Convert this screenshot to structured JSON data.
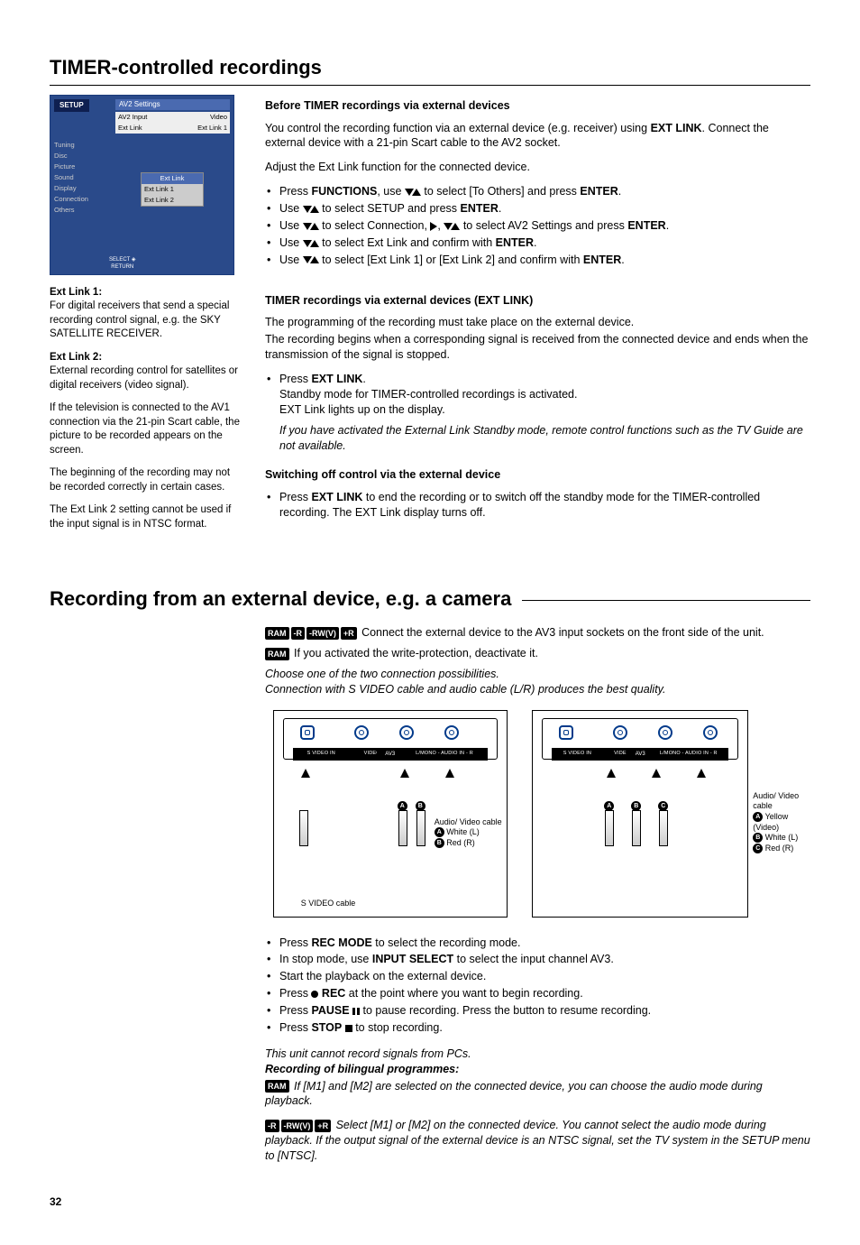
{
  "page_number": "32",
  "section1": {
    "title": "TIMER-controlled recordings",
    "setup_box": {
      "corner": "SETUP",
      "pane_title": "AV2 Settings",
      "rows": [
        {
          "l": "AV2 Input",
          "r": "Video"
        },
        {
          "l": "Ext Link",
          "r": "Ext Link 1"
        }
      ],
      "menu": [
        "Tuning",
        "Disc",
        "Picture",
        "Sound",
        "Display",
        "Connection",
        "Others"
      ],
      "popup_title": "Ext Link",
      "popup_items": [
        "Ext Link 1",
        "Ext Link 2"
      ],
      "hint1": "SELECT",
      "hint2": "RETURN"
    },
    "left": {
      "el1_label": "Ext Link 1:",
      "el1_text": "For digital receivers that send a special recording control signal, e.g. the SKY SATELLITE RECEIVER.",
      "el2_label": "Ext Link 2:",
      "el2_text": "External recording control for satellites or digital receivers (video signal).",
      "p3": "If the television is connected to the AV1 connection via the 21-pin Scart cable, the picture to be recorded appears on the screen.",
      "p4": "The beginning of the recording may not be recorded correctly in certain cases.",
      "p5": "The Ext Link 2 setting cannot be used if the input signal is in NTSC format."
    },
    "right": {
      "h1": "Before TIMER recordings via external devices",
      "p1a": "You control the recording function via an external device (e.g. receiver) using ",
      "p1b": "EXT LINK",
      "p1c": ". Connect the external device with a 21-pin Scart cable to the AV2 socket.",
      "p2": "Adjust the Ext Link function for the connected device.",
      "b1a": "Press ",
      "b1b": "FUNCTIONS",
      "b1c": ", use ",
      "b1d": " to select [To Others] and press ",
      "b1e": "ENTER",
      "b1f": ".",
      "b2a": "Use ",
      "b2b": " to select SETUP and press ",
      "b2c": "ENTER",
      "b2d": ".",
      "b3a": "Use ",
      "b3b": " to select Connection, ",
      "b3c": ", ",
      "b3d": " to select AV2 Settings and press ",
      "b3e": "ENTER",
      "b3f": ".",
      "b4a": "Use ",
      "b4b": " to select Ext Link and confirm with ",
      "b4c": "ENTER",
      "b4d": ".",
      "b5a": "Use ",
      "b5b": " to select [Ext Link 1] or [Ext Link 2] and confirm with ",
      "b5c": "ENTER",
      "b5d": ".",
      "h2": "TIMER recordings via external devices (EXT LINK)",
      "p3": "The programming of the recording must take place on the external device.",
      "p4": "The recording begins when a corresponding signal is received from the connected device and ends when the transmission of the signal is stopped.",
      "b6a": "Press ",
      "b6b": "EXT LINK",
      "b6c": ".",
      "b6d": "Standby mode for TIMER-controlled recordings is activated.",
      "b6e": "EXT Link lights up on the display.",
      "p5": "If you have activated the External Link Standby mode, remote control functions such as the TV Guide are not available.",
      "h3": "Switching off control via the external device",
      "b7a": "Press ",
      "b7b": "EXT LINK",
      "b7c": " to end the recording or to switch off the standby mode for the TIMER-controlled recording. The EXT Link display turns off."
    }
  },
  "section2": {
    "title": "Recording from an external device, e.g. a camera",
    "badges1": [
      "RAM",
      "-R",
      "-RW(V)",
      "+R"
    ],
    "line1": " Connect the external device to the AV3 input sockets on the front side of the unit.",
    "badge_ram": "RAM",
    "line2": " If you activated the write-protection, deactivate it.",
    "it1": "Choose one of the two connection possibilities.",
    "it2": "Connection with S VIDEO cable and audio cable (L/R) produces the best quality.",
    "panel_labels": [
      "S VIDEO IN",
      "VIDEO IN",
      "L/MONO - AUDIO IN - R"
    ],
    "panel_group": "AV3",
    "diag1": {
      "svideo": "S VIDEO cable",
      "av": "Audio/ Video cable",
      "a": "White (L)",
      "b": "Red (R)"
    },
    "diag2": {
      "av": "Audio/ Video cable",
      "a": "Yellow (Video)",
      "b": "White (L)",
      "c": "Red (R)"
    },
    "bul": {
      "b1a": "Press ",
      "b1b": "REC MODE",
      "b1c": " to select the recording mode.",
      "b2a": "In stop mode, use ",
      "b2b": "INPUT SELECT",
      "b2c": " to select the input channel AV3.",
      "b3": "Start the playback on the external device.",
      "b4a": "Press ",
      "b4b": " REC",
      "b4c": " at the point where you want to begin recording.",
      "b5a": "Press ",
      "b5b": "PAUSE",
      "b5c": " to pause recording. Press the button to resume recording.",
      "b6a": "Press ",
      "b6b": "STOP",
      "b6c": " to stop recording."
    },
    "it3": "This unit cannot record signals from PCs.",
    "it4": "Recording of bilingual programmes:",
    "p_ram": " If [M1] and [M2] are selected on the connected device, you can choose the audio mode during playback.",
    "badges2": [
      "-R",
      "-RW(V)",
      "+R"
    ],
    "p_other": " Select [M1] or [M2] on the connected device. You cannot select the audio mode during playback. If the output signal of the external device is an NTSC signal, set the TV system in the SETUP menu to [NTSC]."
  }
}
